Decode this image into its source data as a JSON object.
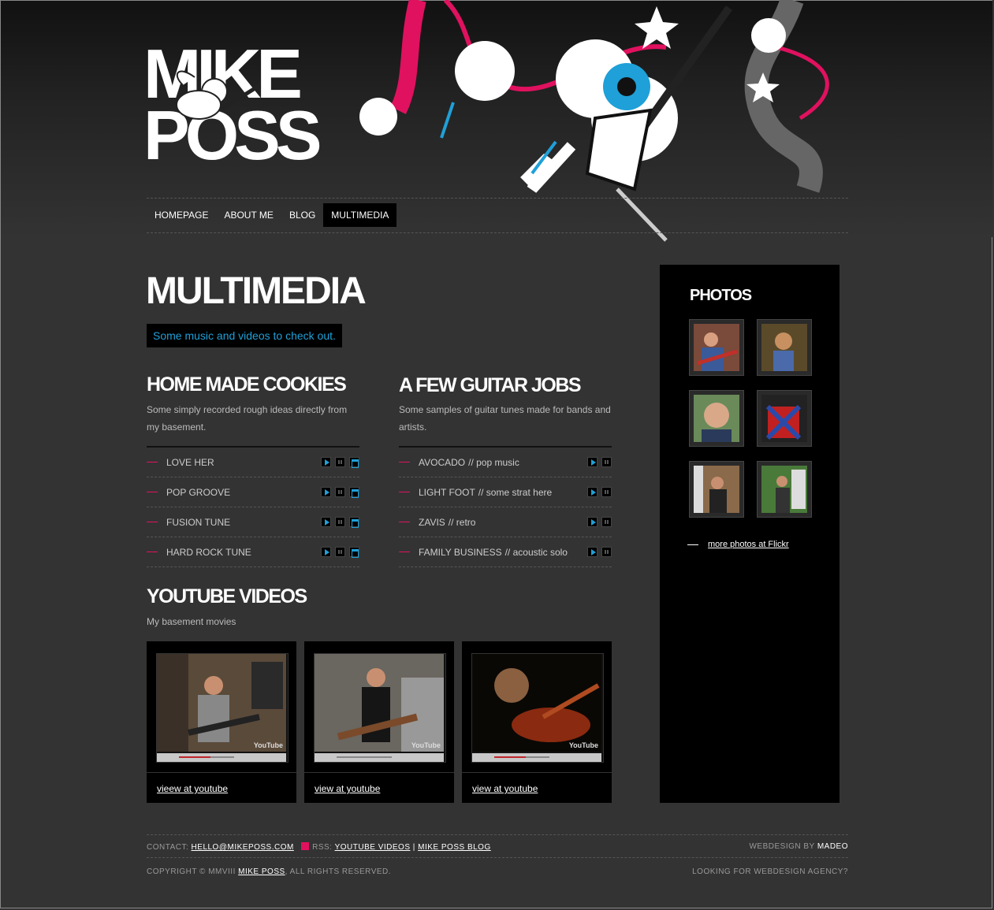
{
  "logo": {
    "line1": "MIKE",
    "line2": "POSS"
  },
  "nav": [
    {
      "label": "HOMEPAGE",
      "active": false
    },
    {
      "label": "ABOUT ME",
      "active": false
    },
    {
      "label": "BLOG",
      "active": false
    },
    {
      "label": "MULTIMEDIA",
      "active": true
    }
  ],
  "page": {
    "title": "MULTIMEDIA",
    "intro": "Some music and videos to check out."
  },
  "home_made": {
    "title": "HOME MADE COOKIES",
    "desc": "Some simply recorded rough ideas directly from my basement.",
    "tracks": [
      {
        "name": "LOVE HER"
      },
      {
        "name": "POP GROOVE"
      },
      {
        "name": "FUSION TUNE"
      },
      {
        "name": "HARD ROCK TUNE"
      }
    ]
  },
  "guitar_jobs": {
    "title": "A FEW GUITAR JOBS",
    "desc": "Some samples of guitar tunes made for bands and artists.",
    "tracks": [
      {
        "name": "AVOCADO",
        "note": "// pop music"
      },
      {
        "name": "LIGHT FOOT",
        "note": "// some strat here"
      },
      {
        "name": "ZAVIS",
        "note": "// retro"
      },
      {
        "name": "FAMILY BUSINESS",
        "note": "// acoustic solo"
      }
    ]
  },
  "youtube": {
    "title": "YOUTUBE VIDEOS",
    "desc": "My basement movies",
    "videos": [
      {
        "link": "vieew at youtube"
      },
      {
        "link": "view at youtube"
      },
      {
        "link": "view at youtube"
      }
    ],
    "badge": "YouTube"
  },
  "sidebar": {
    "title": "PHOTOS",
    "flickr_link": "more photos at Flickr"
  },
  "footer": {
    "contact_label": "CONTACT:",
    "email": "HELLO@MIKEPOSS.COM",
    "rss_label": "RSS:",
    "rss_link1": "YOUTUBE VIDEOS",
    "rss_sep": "|",
    "rss_link2": "MIKE POSS BLOG",
    "webdesign_label": "WEBDESIGN BY",
    "webdesign_name": "MADEO",
    "copyright_prefix": "COPYRIGHT © MMVIII",
    "copyright_name": "MIKE POSS",
    "copyright_suffix": ", ALL RIGHTS RESERVED.",
    "agency": "LOOKING FOR WEBDESIGN AGENCY?"
  },
  "colors": {
    "accent": "#1fa0d8",
    "pink": "#e0115f",
    "background": "#333333"
  }
}
